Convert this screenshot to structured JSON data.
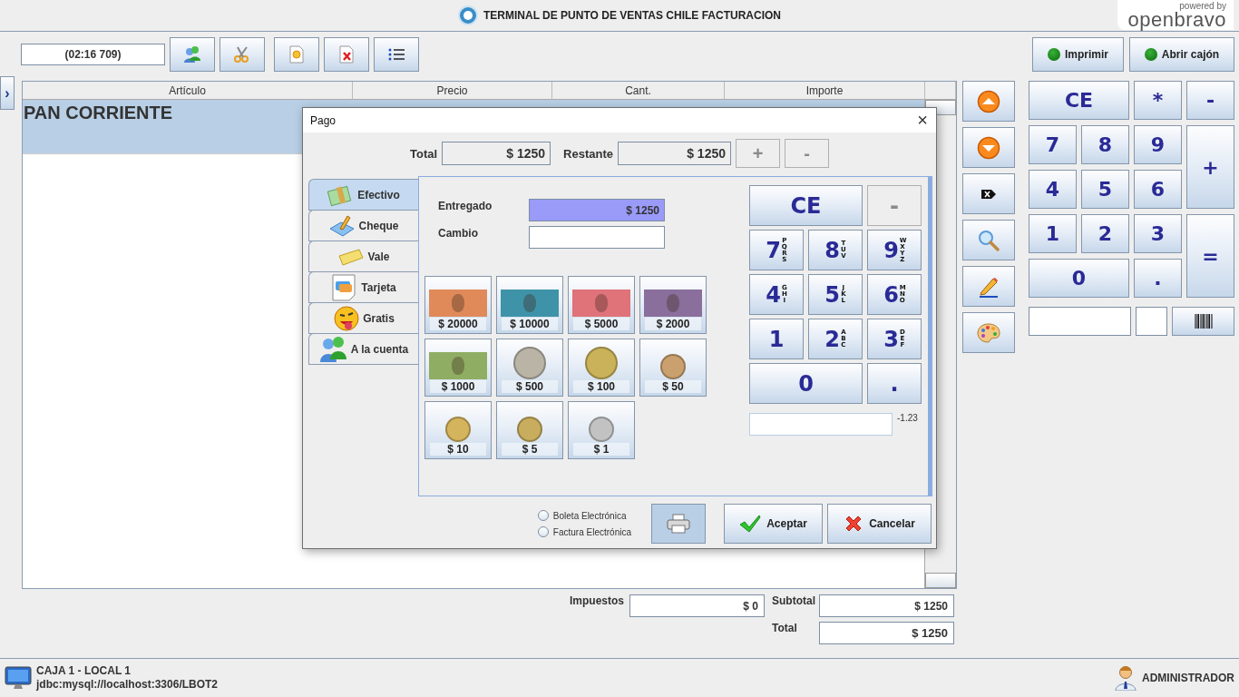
{
  "header": {
    "title": "TERMINAL DE PUNTO DE VENTAS CHILE FACTURACION",
    "brand_caption": "powered by",
    "brand": "openbravo"
  },
  "toolbar": {
    "ticket_id": "(02:16 709)"
  },
  "expander": "›",
  "device_buttons": [
    {
      "label": "Imprimir",
      "on": true
    },
    {
      "label": "Abrir cajón",
      "on": true
    }
  ],
  "ticket": {
    "columns": [
      "Artículo",
      "Precio",
      "Cant.",
      "Importe"
    ],
    "rows": [
      {
        "name": "PAN CORRIENTE",
        "selected": true
      }
    ]
  },
  "keypad": [
    {
      "label": "CE",
      "kind": "wide"
    },
    {
      "label": "*",
      "kind": "normal"
    },
    {
      "label": "-",
      "kind": "normal"
    },
    {
      "label": "7",
      "kind": "normal"
    },
    {
      "label": "8",
      "kind": "normal"
    },
    {
      "label": "9",
      "kind": "normal"
    },
    {
      "label": "+",
      "kind": "tall"
    },
    {
      "label": "4",
      "kind": "normal"
    },
    {
      "label": "5",
      "kind": "normal"
    },
    {
      "label": "6",
      "kind": "normal"
    },
    {
      "label": "1",
      "kind": "normal"
    },
    {
      "label": "2",
      "kind": "normal"
    },
    {
      "label": "3",
      "kind": "normal"
    },
    {
      "label": "=",
      "kind": "tall"
    },
    {
      "label": "0",
      "kind": "wide"
    },
    {
      "label": ".",
      "kind": "normal"
    }
  ],
  "totals": {
    "taxes_label": "Impuestos",
    "taxes": "$ 0",
    "subtotal_label": "Subtotal",
    "subtotal": "$ 1250",
    "total_label": "Total",
    "total": "$ 1250"
  },
  "status_bar": {
    "terminal": "CAJA 1 - LOCAL 1",
    "connection": "jdbc:mysql://localhost:3306/LBOT2",
    "user": "ADMINISTRADOR"
  },
  "dialog": {
    "title": "Pago",
    "close": "×",
    "total_label": "Total",
    "total": "$ 1250",
    "remaining_label": "Restante",
    "remaining": "$ 1250",
    "adjust_buttons": [
      {
        "label": "+",
        "disabled": true
      },
      {
        "label": "-",
        "disabled": true
      }
    ],
    "tabs": [
      {
        "label": "Efectivo",
        "kind": "cash",
        "selected": true
      },
      {
        "label": "Cheque",
        "kind": "cheque",
        "selected": false
      },
      {
        "label": "Vale",
        "kind": "voucher",
        "selected": false
      },
      {
        "label": "Tarjeta",
        "kind": "card",
        "selected": false
      },
      {
        "label": "Gratis",
        "kind": "free",
        "selected": false
      },
      {
        "label": "A la cuenta",
        "kind": "account",
        "selected": false
      }
    ],
    "given_label": "Entregado",
    "given": "$ 1250",
    "change_label": "Cambio",
    "denominations": [
      {
        "label": "$ 20000",
        "kind": "bill",
        "color": "#e08a5a"
      },
      {
        "label": "$ 10000",
        "kind": "bill",
        "color": "#3f93a8"
      },
      {
        "label": "$ 5000",
        "kind": "bill",
        "color": "#e0727a"
      },
      {
        "label": "$ 2000",
        "kind": "bill",
        "color": "#8a6f9c"
      },
      {
        "label": "$ 1000",
        "kind": "bill",
        "color": "#8fae63"
      },
      {
        "label": "$ 500",
        "kind": "coin",
        "color": "#b9b4a6"
      },
      {
        "label": "$ 100",
        "kind": "coin",
        "color": "#c9b25a"
      },
      {
        "label": "$ 50",
        "kind": "coin",
        "color": "#c9a06e"
      },
      {
        "label": "$ 10",
        "kind": "coin",
        "color": "#d4b45c"
      },
      {
        "label": "$ 5",
        "kind": "coin",
        "color": "#c8ad5e"
      },
      {
        "label": "$ 1",
        "kind": "coin",
        "color": "#c2c2c2"
      }
    ],
    "keypad": [
      {
        "digit": "CE",
        "kind": "wide",
        "disabled": false
      },
      {
        "digit": "-",
        "kind": "normal",
        "disabled": true
      },
      {
        "digit": "7",
        "letters": "PQRS",
        "kind": "normal",
        "disabled": false
      },
      {
        "digit": "8",
        "letters": "TUV",
        "kind": "normal",
        "disabled": false
      },
      {
        "digit": "9",
        "letters": "WXYZ",
        "kind": "normal",
        "disabled": false
      },
      {
        "digit": "4",
        "letters": "GHI",
        "kind": "normal",
        "disabled": false
      },
      {
        "digit": "5",
        "letters": "JKL",
        "kind": "normal",
        "disabled": false
      },
      {
        "digit": "6",
        "letters": "MNO",
        "kind": "normal",
        "disabled": false
      },
      {
        "digit": "1",
        "kind": "normal",
        "disabled": false
      },
      {
        "digit": "2",
        "letters": "ABC",
        "kind": "normal",
        "disabled": false
      },
      {
        "digit": "3",
        "letters": "DEF",
        "kind": "normal",
        "disabled": false
      },
      {
        "digit": "0",
        "kind": "wide",
        "disabled": false
      },
      {
        "digit": ".",
        "kind": "normal",
        "disabled": false
      }
    ],
    "keypad_hint": "-1.23",
    "document_types": [
      {
        "label": "Boleta Electrónica",
        "selected": false
      },
      {
        "label": "Factura Electrónica",
        "selected": false
      }
    ],
    "accept": "Aceptar",
    "cancel": "Cancelar"
  }
}
